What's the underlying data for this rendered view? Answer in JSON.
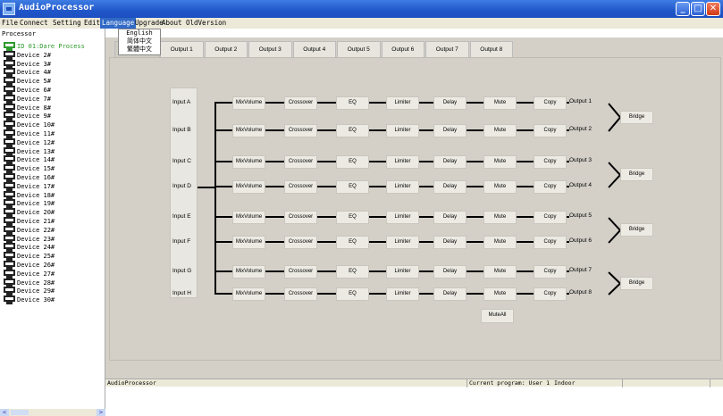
{
  "window": {
    "title": "AudioProcessor",
    "min_label": "_",
    "max_label": "□",
    "close_label": "✕"
  },
  "menu": {
    "file": "File",
    "connect": "Connect",
    "setting": "Setting",
    "edit": "Edit",
    "language": "Language",
    "upgrade": "Upgrade",
    "about": "About",
    "oldversion": "OldVersion"
  },
  "language_menu": {
    "english": "English",
    "simplified": "简体中文",
    "traditional": "繁體中文"
  },
  "sidebar": {
    "root": "Processor",
    "items": [
      "ID 01:Dare Process",
      "Device 2#",
      "Device 3#",
      "Device 4#",
      "Device 5#",
      "Device 6#",
      "Device 7#",
      "Device 8#",
      "Device 9#",
      "Device 10#",
      "Device 11#",
      "Device 12#",
      "Device 13#",
      "Device 14#",
      "Device 15#",
      "Device 16#",
      "Device 17#",
      "Device 18#",
      "Device 19#",
      "Device 20#",
      "Device 21#",
      "Device 22#",
      "Device 23#",
      "Device 24#",
      "Device 25#",
      "Device 26#",
      "Device 27#",
      "Device 28#",
      "Device 29#",
      "Device 30#"
    ],
    "scroll_left": "<",
    "scroll_right": ">"
  },
  "tabs": [
    "Output 1",
    "Output 2",
    "Output 3",
    "Output 4",
    "Output 5",
    "Output 6",
    "Output 7",
    "Output 8"
  ],
  "inputs": [
    "Input A",
    "Input B",
    "Input C",
    "Input D",
    "Input E",
    "Input F",
    "Input G",
    "Input H"
  ],
  "chain": [
    "MixVolume",
    "Crossover",
    "EQ",
    "Limiter",
    "Delay",
    "Mute",
    "Copy"
  ],
  "outputs": [
    "Output 1",
    "Output 2",
    "Output 3",
    "Output 4",
    "Output 5",
    "Output 6",
    "Output 7",
    "Output 8"
  ],
  "bridge_label": "Bridge",
  "muteall_label": "MuteAll",
  "status": {
    "app": "AudioProcessor",
    "program": "Current program: User 1",
    "location": "Indoor"
  }
}
